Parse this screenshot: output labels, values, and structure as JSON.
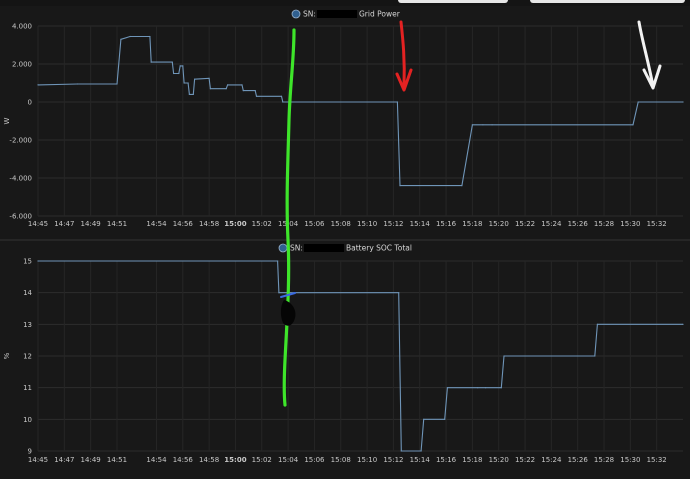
{
  "chart_data": [
    {
      "type": "line",
      "legend": {
        "prefix": "SN:",
        "name": "Grid Power"
      },
      "ylabel": "W",
      "ylim": [
        -6000,
        4000
      ],
      "yticks": [
        4000,
        2000,
        0,
        -2000,
        -4000,
        -6000
      ],
      "ytick_labels": [
        "4.000",
        "2.000",
        "0",
        "-2.000",
        "-4.000",
        "-6.000"
      ],
      "x_range": [
        "14:45",
        "15:34"
      ],
      "xticks": [
        "14:45",
        "14:47",
        "14:49",
        "14:51",
        "14:54",
        "14:56",
        "14:58",
        "15:00",
        "15:02",
        "15:04",
        "15:06",
        "15:08",
        "15:10",
        "15:12",
        "15:14",
        "15:16",
        "15:18",
        "15:20",
        "15:22",
        "15:24",
        "15:26",
        "15:28",
        "15:30",
        "15:32"
      ],
      "series": [
        {
          "points": [
            [
              "14:45",
              900
            ],
            [
              "14:48",
              950
            ],
            [
              "14:51",
              950
            ],
            [
              "14:51.3",
              3300
            ],
            [
              "14:52",
              3450
            ],
            [
              "14:53.5",
              3450
            ],
            [
              "14:53.6",
              2100
            ],
            [
              "14:55.2",
              2100
            ],
            [
              "14:55.3",
              1500
            ],
            [
              "14:55.7",
              1500
            ],
            [
              "14:55.8",
              1900
            ],
            [
              "14:56",
              1900
            ],
            [
              "14:56.1",
              1000
            ],
            [
              "14:56.4",
              1000
            ],
            [
              "14:56.5",
              400
            ],
            [
              "14:56.8",
              400
            ],
            [
              "14:56.9",
              1200
            ],
            [
              "14:58",
              1250
            ],
            [
              "14:58.1",
              700
            ],
            [
              "14:59.3",
              700
            ],
            [
              "14:59.4",
              900
            ],
            [
              "15:00.5",
              900
            ],
            [
              "15:00.6",
              600
            ],
            [
              "15:01.5",
              600
            ],
            [
              "15:01.6",
              300
            ],
            [
              "15:03.5",
              300
            ],
            [
              "15:03.6",
              0
            ],
            [
              "15:12.3",
              0
            ],
            [
              "15:12.5",
              -4400
            ],
            [
              "15:17.2",
              -4400
            ],
            [
              "15:18",
              -1200
            ],
            [
              "15:18.8",
              -1200
            ],
            [
              "15:19.5",
              -1200
            ],
            [
              "15:30.2",
              -1200
            ],
            [
              "15:30.6",
              0
            ],
            [
              "15:34",
              0
            ]
          ]
        }
      ]
    },
    {
      "type": "line",
      "legend": {
        "prefix": "SN:",
        "name": "Battery SOC Total"
      },
      "ylabel": "%",
      "ylim": [
        9,
        15
      ],
      "yticks": [
        15,
        14,
        13,
        12,
        11,
        10,
        9
      ],
      "ytick_labels": [
        "15",
        "14",
        "13",
        "12",
        "11",
        "10",
        "9"
      ],
      "x_range": [
        "14:45",
        "15:34"
      ],
      "xticks": [
        "14:45",
        "14:47",
        "14:49",
        "14:51",
        "14:54",
        "14:56",
        "14:58",
        "15:00",
        "15:02",
        "15:04",
        "15:06",
        "15:08",
        "15:10",
        "15:12",
        "15:14",
        "15:16",
        "15:18",
        "15:20",
        "15:22",
        "15:24",
        "15:26",
        "15:28",
        "15:30",
        "15:32"
      ],
      "series": [
        {
          "points": [
            [
              "14:45",
              15
            ],
            [
              "15:03.2",
              15
            ],
            [
              "15:03.3",
              14
            ],
            [
              "15:12.4",
              14
            ],
            [
              "15:12.6",
              9
            ],
            [
              "15:14.1",
              9
            ],
            [
              "15:14.3",
              10
            ],
            [
              "15:15.9",
              10
            ],
            [
              "15:16.1",
              11
            ],
            [
              "15:18.4",
              11
            ],
            [
              "15:19",
              11
            ],
            [
              "15:20.2",
              11
            ],
            [
              "15:20.4",
              12
            ],
            [
              "15:27.3",
              12
            ],
            [
              "15:27.5",
              13
            ],
            [
              "15:34",
              13
            ]
          ]
        }
      ]
    }
  ]
}
